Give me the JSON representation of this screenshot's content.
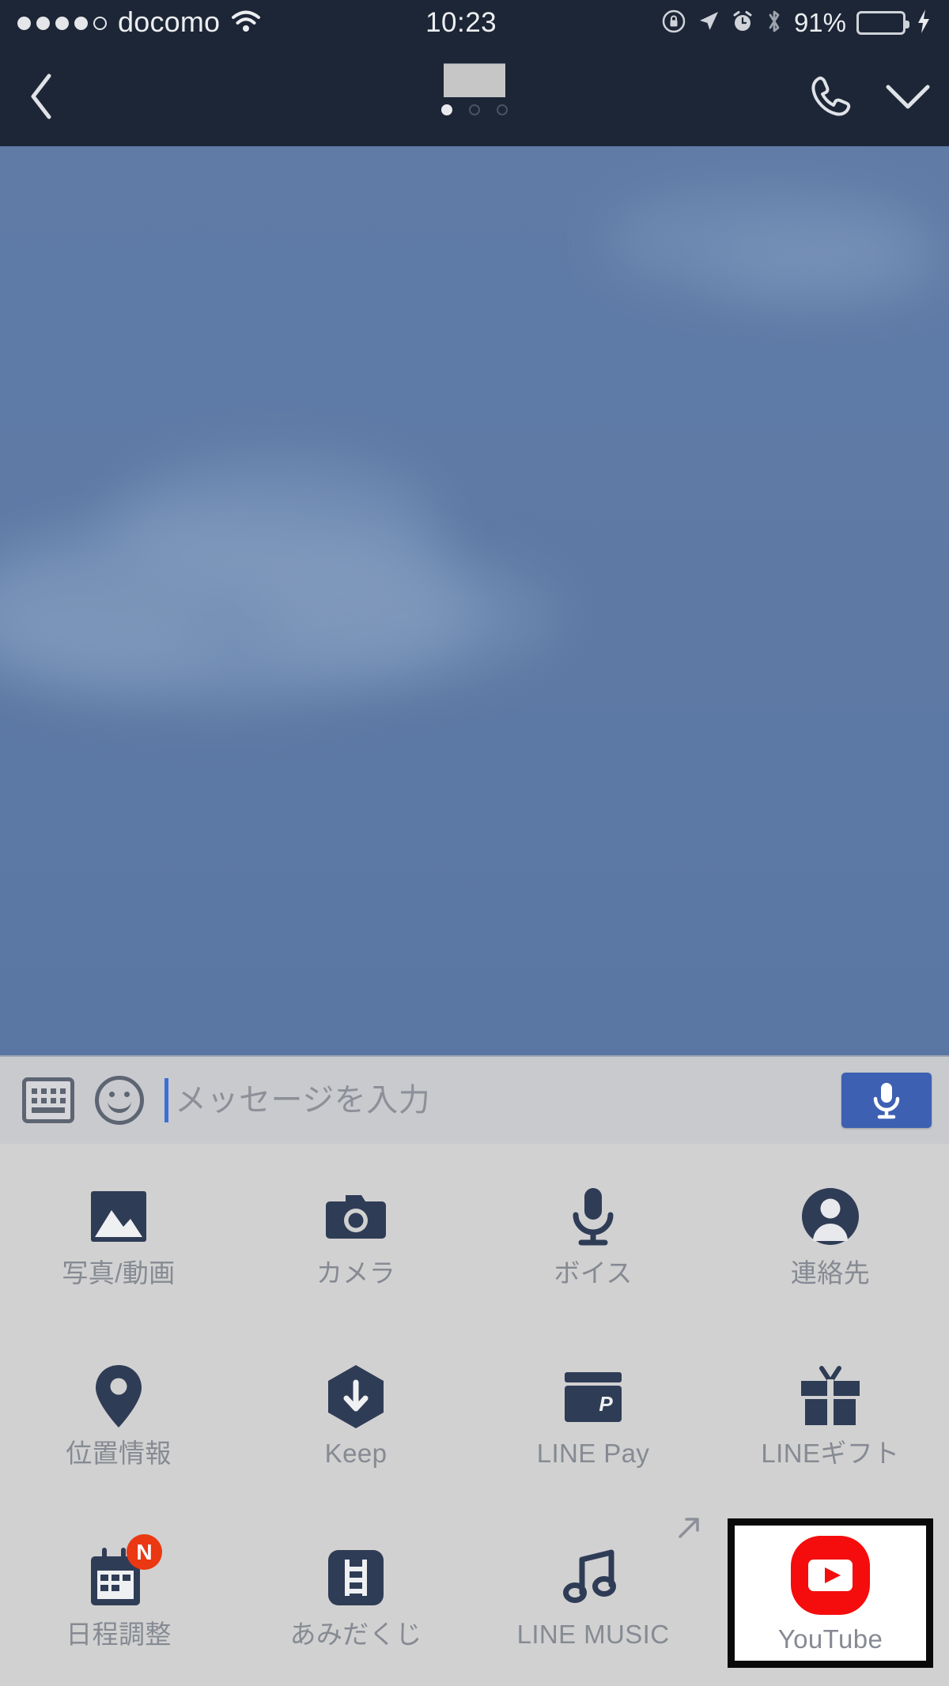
{
  "status_bar": {
    "carrier": "docomo",
    "signal_bars_filled": 4,
    "signal_bars_total": 5,
    "wifi_icon": "wifi-icon",
    "time": "10:23",
    "icons": [
      "rotation-lock-icon",
      "location-arrow-icon",
      "alarm-clock-icon",
      "bluetooth-icon"
    ],
    "battery_percent": "91%",
    "battery_fill_ratio": 0.91,
    "battery_color": "#2fd336",
    "charging": true,
    "background_color": "#1d2636"
  },
  "nav_bar": {
    "back_icon": "back-chevron-icon",
    "title_masked": true,
    "page_dots": {
      "count": 3,
      "active_index": 0
    },
    "call_icon": "phone-call-icon",
    "collapse_icon": "chevron-down-icon",
    "background_color": "#1d2636"
  },
  "chat_area": {
    "background_description": "blue-sky-photo-wallpaper",
    "background_color": "#5d79a4"
  },
  "input_bar": {
    "keyboard_icon": "keyboard-icon",
    "emoji_icon": "smiley-face-icon",
    "message_placeholder": "メッセージを入力",
    "message_value": "",
    "caret_color": "#3d6fd6",
    "mic_button_icon": "microphone-icon",
    "mic_button_color": "#3d60b2",
    "background_color": "#c9cace"
  },
  "attachment_panel": {
    "background_color": "#d1d1d1",
    "icon_color": "#2f3c56",
    "label_color": "#868a93",
    "items": [
      {
        "label": "写真/動画",
        "icon": "photo-video-icon",
        "badge": null,
        "external": false,
        "highlighted": false
      },
      {
        "label": "カメラ",
        "icon": "camera-icon",
        "badge": null,
        "external": false,
        "highlighted": false
      },
      {
        "label": "ボイス",
        "icon": "voice-microphone-icon",
        "badge": null,
        "external": false,
        "highlighted": false
      },
      {
        "label": "連絡先",
        "icon": "contact-person-icon",
        "badge": null,
        "external": false,
        "highlighted": false
      },
      {
        "label": "位置情報",
        "icon": "location-pin-icon",
        "badge": null,
        "external": false,
        "highlighted": false
      },
      {
        "label": "Keep",
        "icon": "keep-hexagon-download-icon",
        "badge": null,
        "external": false,
        "highlighted": false
      },
      {
        "label": "LINE Pay",
        "icon": "line-pay-card-icon",
        "badge": null,
        "external": false,
        "highlighted": false
      },
      {
        "label": "LINEギフト",
        "icon": "gift-box-icon",
        "badge": null,
        "external": false,
        "highlighted": false
      },
      {
        "label": "日程調整",
        "icon": "calendar-icon",
        "badge": "N",
        "external": false,
        "highlighted": false
      },
      {
        "label": "あみだくじ",
        "icon": "amidakuji-ladder-icon",
        "badge": null,
        "external": false,
        "highlighted": false
      },
      {
        "label": "LINE MUSIC",
        "icon": "music-note-icon",
        "badge": null,
        "external": true,
        "highlighted": false
      },
      {
        "label": "YouTube",
        "icon": "youtube-icon",
        "badge": null,
        "external": false,
        "highlighted": true
      }
    ]
  }
}
